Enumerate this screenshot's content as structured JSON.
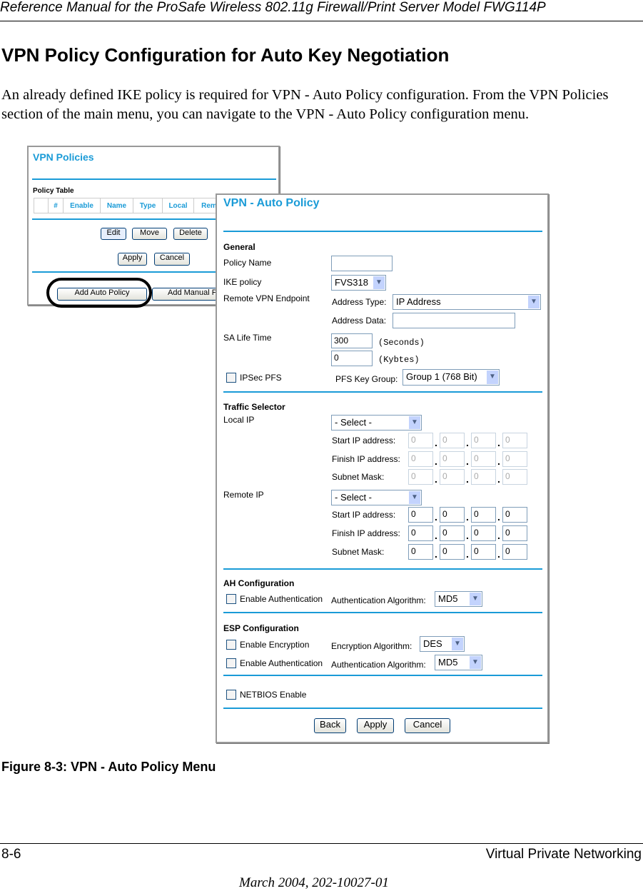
{
  "header": {
    "running_title": "Reference Manual for the ProSafe Wireless 802.11g  Firewall/Print Server Model FWG114P"
  },
  "section": {
    "title": "VPN Policy Configuration for Auto Key Negotiation",
    "paragraph": "An already defined IKE policy is required for VPN - Auto Policy configuration. From the VPN Policies section of the main menu, you can navigate to the VPN - Auto Policy configuration menu."
  },
  "vpn_policies": {
    "title": "VPN Policies",
    "table_label": "Policy Table",
    "columns": [
      "",
      "#",
      "Enable",
      "Name",
      "Type",
      "Local",
      "Remo"
    ],
    "edit": "Edit",
    "move": "Move",
    "delete": "Delete",
    "apply": "Apply",
    "cancel": "Cancel",
    "add_auto": "Add Auto Policy",
    "add_manual": "Add Manual P"
  },
  "auto_policy": {
    "title": "VPN - Auto Policy",
    "general": "General",
    "policy_name_label": "Policy Name",
    "policy_name_value": "",
    "ike_policy_label": "IKE policy",
    "ike_policy_value": "FVS318",
    "remote_endpoint_label": "Remote VPN Endpoint",
    "address_type_label": "Address Type:",
    "address_type_value": "IP Address",
    "address_data_label": "Address Data:",
    "address_data_value": "",
    "sa_life_label": "SA Life Time",
    "sa_seconds": "300",
    "seconds_unit": "(Seconds)",
    "sa_kbytes": "0",
    "kbytes_unit": "(Kybtes)",
    "ipsec_pfs_label": "IPSec PFS",
    "pfs_group_label": "PFS Key Group:",
    "pfs_group_value": "Group 1 (768 Bit)",
    "traffic_selector": "Traffic Selector",
    "local_ip_label": "Local IP",
    "local_ip_value": "- Select -",
    "remote_ip_label": "Remote IP",
    "remote_ip_value": "- Select -",
    "start_ip_label": "Start IP address:",
    "finish_ip_label": "Finish IP address:",
    "subnet_label": "Subnet Mask:",
    "octet": "0",
    "ah_config": "AH Configuration",
    "enable_auth_label": "Enable Authentication",
    "auth_alg_label": "Authentication Algorithm:",
    "ah_auth_alg_value": "MD5",
    "esp_config": "ESP Configuration",
    "enable_enc_label": "Enable Encryption",
    "enc_alg_label": "Encryption Algorithm:",
    "enc_alg_value": "DES",
    "esp_auth_alg_value": "MD5",
    "netbios_label": "NETBIOS Enable",
    "back": "Back",
    "apply": "Apply",
    "cancel": "Cancel"
  },
  "figure": {
    "caption": "Figure 8-3:  VPN - Auto Policy Menu"
  },
  "footer": {
    "page": "8-6",
    "chapter": "Virtual Private Networking",
    "date": "March 2004, 202-10027-01"
  }
}
